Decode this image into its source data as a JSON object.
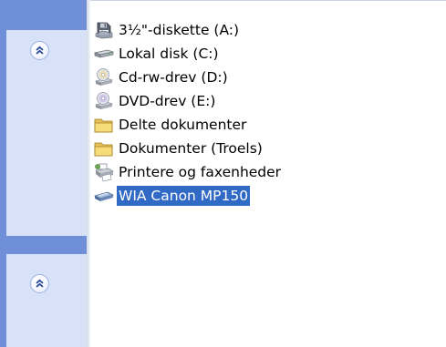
{
  "task_pane": {
    "sections": [
      {
        "collapse_icon": "double-chevron-up-icon"
      },
      {
        "collapse_icon": "double-chevron-up-icon"
      }
    ]
  },
  "files": {
    "items": [
      {
        "label": "3½\"-diskette (A:)",
        "icon": "floppy-drive-icon"
      },
      {
        "label": "Lokal disk (C:)",
        "icon": "hard-disk-icon"
      },
      {
        "label": "Cd-rw-drev (D:)",
        "icon": "cd-drive-icon"
      },
      {
        "label": "DVD-drev (E:)",
        "icon": "dvd-drive-icon"
      },
      {
        "label": "Delte dokumenter",
        "icon": "folder-icon"
      },
      {
        "label": "Dokumenter (Troels)",
        "icon": "folder-icon"
      },
      {
        "label": "Printere og faxenheder",
        "icon": "printer-icon"
      },
      {
        "label": "WIA Canon MP150",
        "icon": "scanner-icon",
        "selected": true
      }
    ]
  },
  "colors": {
    "pane_background": "#6f90d9",
    "section_background": "#d7e2f9",
    "selection_background": "#316ac5",
    "selection_text": "#ffffff"
  }
}
